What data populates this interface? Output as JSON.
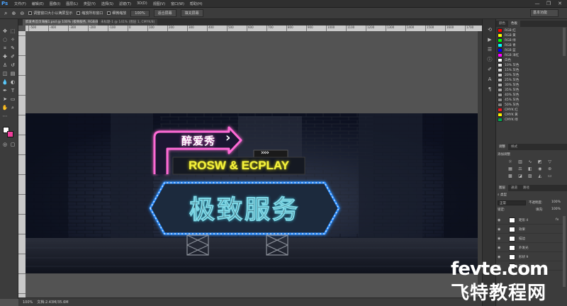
{
  "app": {
    "logo": "Ps"
  },
  "menu": [
    "文件(F)",
    "编辑(E)",
    "图像(I)",
    "图层(L)",
    "类型(Y)",
    "选择(S)",
    "滤镜(T)",
    "3D(D)",
    "视图(V)",
    "窗口(W)",
    "帮助(H)"
  ],
  "window_controls": {
    "minimize": "—",
    "restore": "❐",
    "close": "✕"
  },
  "options": {
    "resize_windows": "调整窗口大小以满屏显示",
    "zoom_all": "缩放所有窗口",
    "scrubby_zoom": "细微缩放",
    "zoom_100": "100%",
    "fit_screen": "适合屏幕",
    "fill_screen": "填充屏幕",
    "workspace": "基本功能"
  },
  "document": {
    "tab_title": "醉爱秀首页海报1.psd @ 100% (极致服务, RGB/8) *",
    "tab_close": "×",
    "second_tab": "未标题-1 @ 141% (图层 1, CMYK/8)",
    "ruler_numbers": [
      "-500",
      "-400",
      "-300",
      "-200",
      "-100",
      "0",
      "100",
      "200",
      "300",
      "400",
      "500",
      "600",
      "700",
      "800",
      "900",
      "1000",
      "1100",
      "1200",
      "1300",
      "1400",
      "1500",
      "1600",
      "1700"
    ]
  },
  "artwork": {
    "sign_top": "醉爱秀",
    "arrow_glyph": "›",
    "chevrons": "››››",
    "brand": "ROSW & ECPLAY",
    "main": "极致服务"
  },
  "status": {
    "zoom": "100%",
    "doc_info": "文档:2.43M/35.6M"
  },
  "panels": {
    "swatches_tabs": [
      "颜色",
      "色板"
    ],
    "swatches": [
      {
        "name": "RGB 红",
        "color": "#ff0000"
      },
      {
        "name": "RGB 黄",
        "color": "#ffff00"
      },
      {
        "name": "RGB 绿",
        "color": "#00ff00"
      },
      {
        "name": "RGB 青",
        "color": "#00ffff"
      },
      {
        "name": "RGB 蓝",
        "color": "#0000ff"
      },
      {
        "name": "RGB 洋红",
        "color": "#ff00ff"
      },
      {
        "name": "白色",
        "color": "#ffffff"
      },
      {
        "name": "10% 灰色",
        "color": "#e6e6e6"
      },
      {
        "name": "15% 灰色",
        "color": "#d9d9d9"
      },
      {
        "name": "20% 灰色",
        "color": "#cccccc"
      },
      {
        "name": "25% 灰色",
        "color": "#bfbfbf"
      },
      {
        "name": "30% 灰色",
        "color": "#b3b3b3"
      },
      {
        "name": "35% 灰色",
        "color": "#a6a6a6"
      },
      {
        "name": "40% 灰色",
        "color": "#999999"
      },
      {
        "name": "45% 灰色",
        "color": "#8c8c8c"
      },
      {
        "name": "50% 灰色",
        "color": "#808080"
      },
      {
        "name": "CMYK 红",
        "color": "#ed1c24"
      },
      {
        "name": "CMYK 黄",
        "color": "#fff200"
      },
      {
        "name": "CMYK 绿",
        "color": "#00a651"
      }
    ],
    "adjust_tabs": [
      "调整",
      "样式"
    ],
    "adjust_title": "添加调整",
    "layers_tabs": [
      "图层",
      "通道",
      "路径"
    ],
    "layers_kind": "类型",
    "blend_mode": "正常",
    "opacity_label": "不透明度:",
    "opacity": "100%",
    "lock_label": "锁定:",
    "fill_label": "填充:",
    "fill": "100%",
    "layers": [
      {
        "name": "矩形 4",
        "fx": "fx"
      },
      {
        "name": "效果",
        "fx": ""
      },
      {
        "name": "描边",
        "fx": ""
      },
      {
        "name": "外发光",
        "fx": ""
      },
      {
        "name": "形状 9",
        "fx": ""
      },
      {
        "name": "矩形 1",
        "fx": ""
      }
    ]
  },
  "watermark": {
    "top": "fevte.com",
    "bottom": "飞特教程网"
  }
}
